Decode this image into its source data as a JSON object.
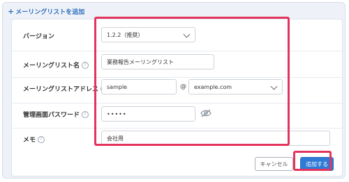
{
  "header": {
    "plus": "+",
    "title": "メーリングリストを追加"
  },
  "form": {
    "version": {
      "label": "バージョン",
      "value": "1.2.2（推奨）"
    },
    "list_name": {
      "label": "メーリングリスト名",
      "value": "業務報告メーリングリスト"
    },
    "address": {
      "label": "メーリングリストアドレス",
      "local": "sample",
      "at": "@",
      "domain": "example.com"
    },
    "password": {
      "label": "管理画面パスワード",
      "value": "•••••"
    },
    "memo": {
      "label": "メモ",
      "value": "会社用"
    }
  },
  "help_glyph": "?",
  "buttons": {
    "cancel": "キャンセル",
    "add": "追加する"
  },
  "colors": {
    "accent": "#2f7ad6",
    "highlight": "#e4335c",
    "header_text": "#2f6fbf"
  },
  "icons": [
    "chevron-down-icon",
    "help-icon",
    "eye-off-icon"
  ]
}
